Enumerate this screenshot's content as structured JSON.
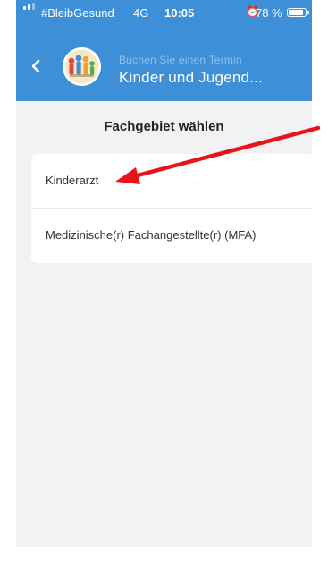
{
  "status_bar": {
    "carrier": "#BleibGesund",
    "network": "4G",
    "time": "10:05",
    "battery": "78 %",
    "battery_level": 0.78,
    "alarm_icon": "alarm-clock-icon",
    "signal_icon": "signal-bars-icon"
  },
  "header": {
    "subtitle": "Buchen Sie einen Termin",
    "title": "Kinder und Jugend...",
    "back_icon": "chevron-left-icon",
    "background_color": "#3d8fd8"
  },
  "main": {
    "section_title": "Fachgebiet wählen",
    "items": [
      {
        "label": "Kinderarzt"
      },
      {
        "label": "Medizinische(r) Fachangestellte(r) (MFA)"
      }
    ]
  },
  "annotation": {
    "arrow_color": "#e8141a",
    "points_to": "Kinderarzt"
  }
}
